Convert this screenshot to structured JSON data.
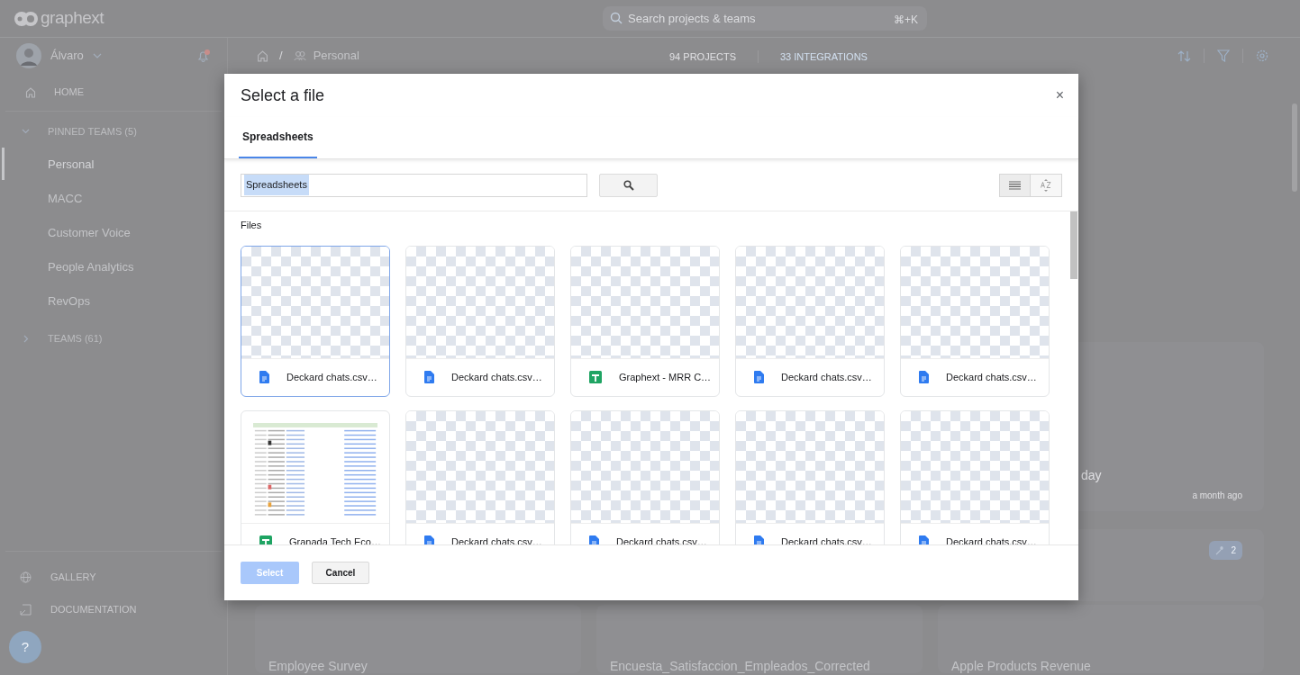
{
  "app": {
    "logo": "graphext",
    "search": {
      "placeholder": "Search projects & teams",
      "shortcut": "⌘+K"
    }
  },
  "sidebar": {
    "user": "Álvaro",
    "home": "HOME",
    "pinned": {
      "label": "PINNED TEAMS (5)",
      "expanded": true,
      "items": [
        {
          "label": "Personal",
          "selected": true
        },
        {
          "label": "MACC",
          "selected": false
        },
        {
          "label": "Customer Voice",
          "selected": false
        },
        {
          "label": "People Analytics",
          "selected": false
        },
        {
          "label": "RevOps",
          "selected": false
        }
      ]
    },
    "teams": {
      "label": "TEAMS (61)",
      "expanded": false
    },
    "footer": [
      "GALLERY",
      "DOCUMENTATION"
    ],
    "help": "?"
  },
  "header": {
    "separator": "/",
    "breadcrumb": "Personal",
    "tabs": [
      {
        "label": "94 PROJECTS",
        "selected": false
      },
      {
        "label": "33 INTEGRATIONS",
        "selected": true
      }
    ]
  },
  "background_cards": [
    {
      "title": "day",
      "time": "a month ago"
    },
    {
      "badge": "2"
    }
  ],
  "bottom_cards": [
    "Employee Survey",
    "Encuesta_Satisfaccion_Empleados_Corrected",
    "Apple Products Revenue"
  ],
  "dialog": {
    "title": "Select a file",
    "close": "×",
    "tabs": [
      {
        "label": "Spreadsheets",
        "selected": true
      }
    ],
    "search_value": "Spreadsheets",
    "section": "Files",
    "files": [
      {
        "name": "Deckard chats.csv…",
        "kind": "doc",
        "has_preview": false,
        "selected": true
      },
      {
        "name": "Deckard chats.csv…",
        "kind": "doc",
        "has_preview": false,
        "selected": false
      },
      {
        "name": "Graphext - MRR C…",
        "kind": "sheet",
        "has_preview": false,
        "selected": false
      },
      {
        "name": "Deckard chats.csv…",
        "kind": "doc",
        "has_preview": false,
        "selected": false
      },
      {
        "name": "Deckard chats.csv…",
        "kind": "doc",
        "has_preview": false,
        "selected": false
      },
      {
        "name": "Granada Tech Eco…",
        "kind": "sheet",
        "has_preview": true,
        "selected": false
      },
      {
        "name": "Deckard chats.csv…",
        "kind": "doc",
        "has_preview": false,
        "selected": false
      },
      {
        "name": "Deckard chats.csv…",
        "kind": "doc",
        "has_preview": false,
        "selected": false
      },
      {
        "name": "Deckard chats.csv…",
        "kind": "doc",
        "has_preview": false,
        "selected": false
      },
      {
        "name": "Deckard chats.csv…",
        "kind": "doc",
        "has_preview": false,
        "selected": false
      }
    ],
    "buttons": [
      {
        "label": "Select",
        "disabled": true
      },
      {
        "label": "Cancel",
        "disabled": false
      }
    ]
  }
}
